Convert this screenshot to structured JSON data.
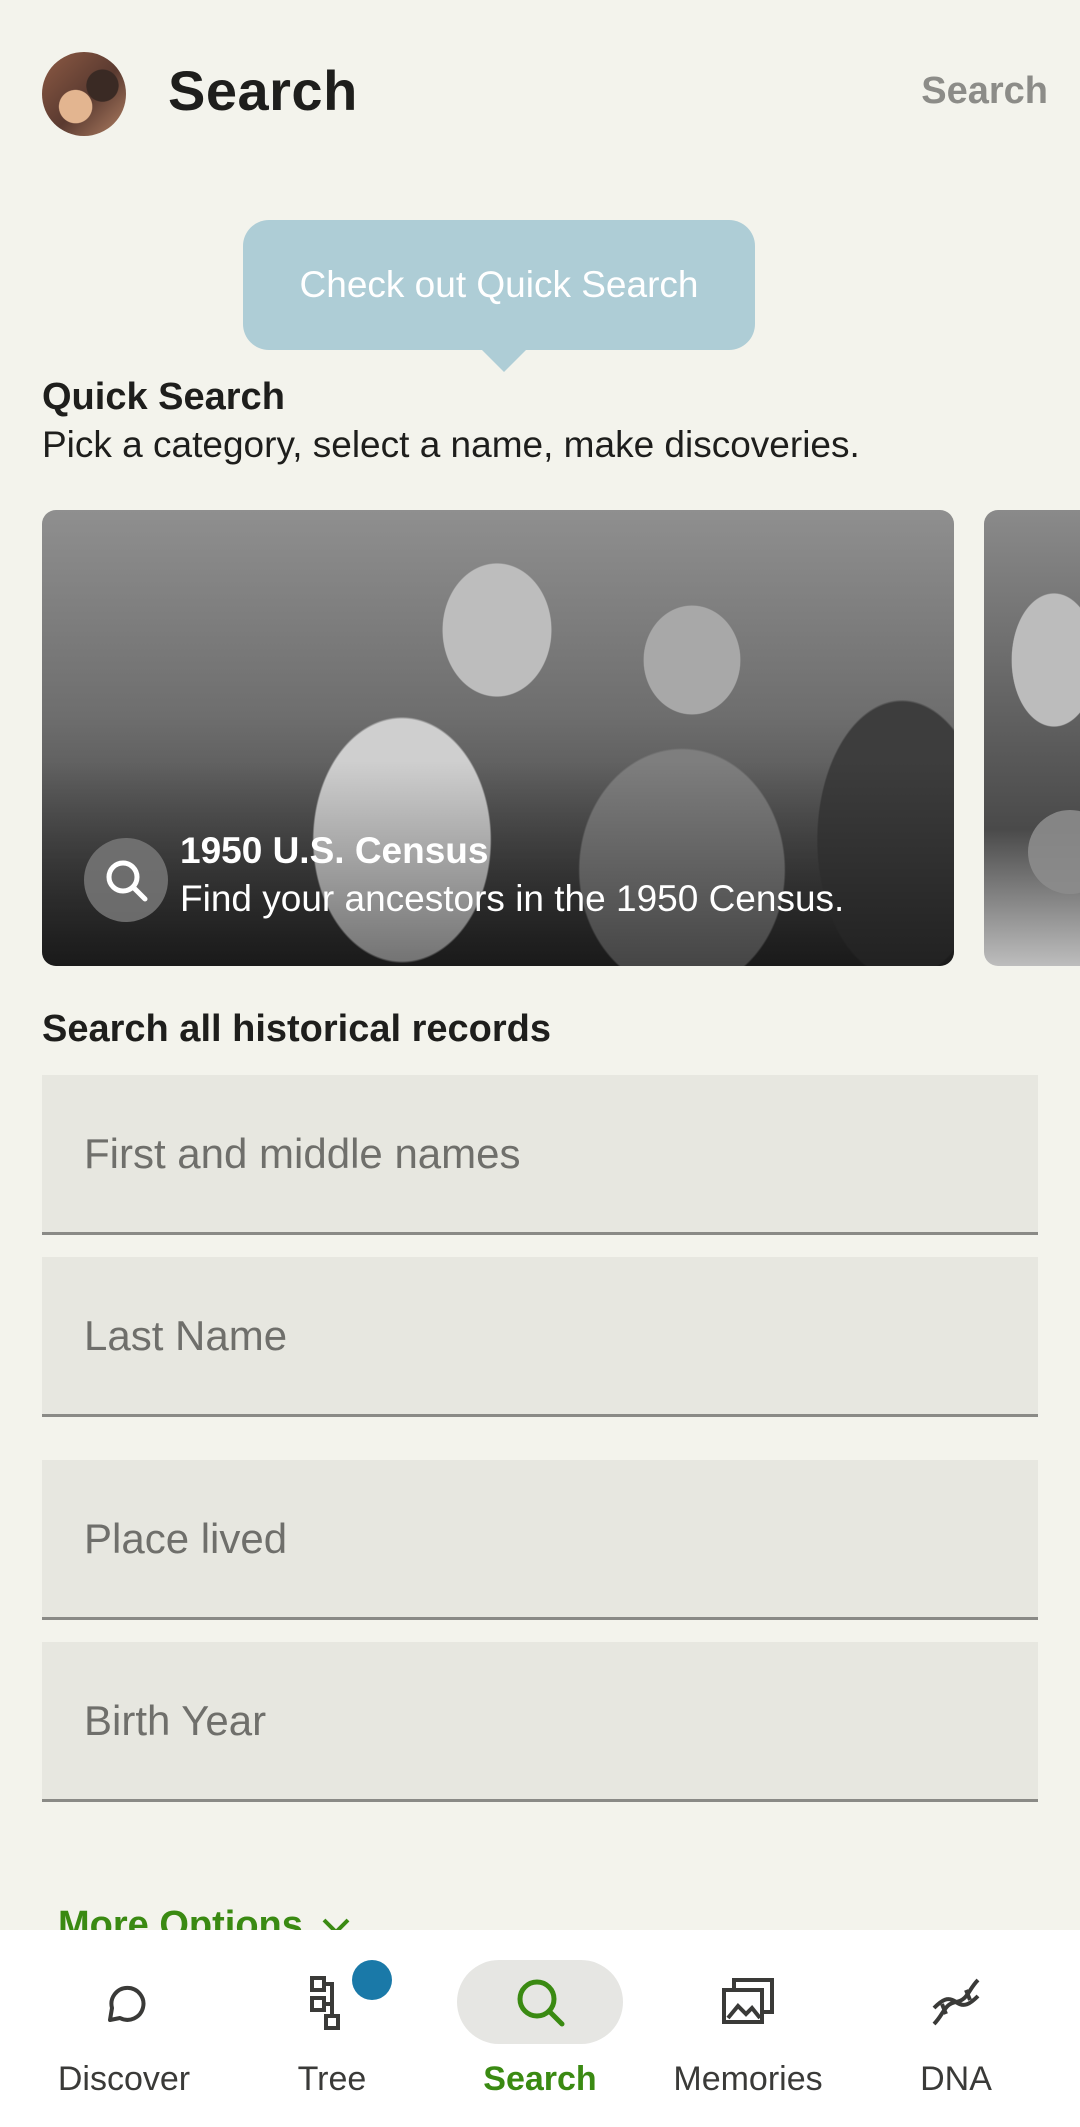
{
  "header": {
    "title": "Search",
    "action_label": "Search"
  },
  "tooltip": {
    "text": "Check out Quick Search"
  },
  "quick_search": {
    "title": "Quick Search",
    "subtitle": "Pick a category, select a name, make discoveries.",
    "cards": [
      {
        "title": "1950 U.S. Census",
        "description": "Find your ancestors in the 1950 Census.",
        "icon": "search-icon"
      }
    ]
  },
  "records": {
    "title": "Search all historical records",
    "fields": [
      {
        "placeholder": "First and middle names",
        "value": ""
      },
      {
        "placeholder": "Last Name",
        "value": ""
      },
      {
        "placeholder": "Place lived",
        "value": ""
      },
      {
        "placeholder": "Birth Year",
        "value": ""
      }
    ],
    "more_options": "More Options"
  },
  "bottom_nav": {
    "items": [
      {
        "label": "Discover",
        "icon": "discover-icon"
      },
      {
        "label": "Tree",
        "icon": "tree-icon",
        "badge": true
      },
      {
        "label": "Search",
        "icon": "search-icon",
        "active": true
      },
      {
        "label": "Memories",
        "icon": "memories-icon"
      },
      {
        "label": "DNA",
        "icon": "dna-icon"
      }
    ]
  },
  "colors": {
    "background": "#f3f3ec",
    "accent_green": "#3a8a12",
    "tooltip": "#aecdd6",
    "badge_blue": "#1a79a8"
  }
}
